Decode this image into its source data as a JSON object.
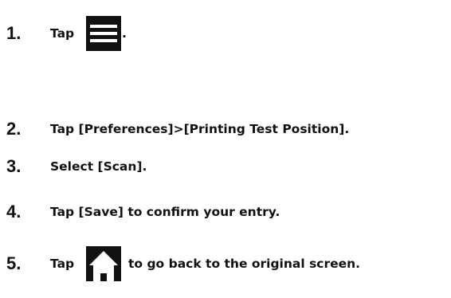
{
  "steps": [
    {
      "number": "1.",
      "before": "Tap",
      "icon": "menu-icon",
      "after": "."
    },
    {
      "number": "2.",
      "text": "Tap [Preferences]>[Printing Test Position]."
    },
    {
      "number": "3.",
      "text": "Select [Scan]."
    },
    {
      "number": "4.",
      "text": "Tap [Save] to confirm your entry."
    },
    {
      "number": "5.",
      "before": "Tap",
      "icon": "home-icon",
      "after": "to go back to the original screen."
    }
  ],
  "colors": {
    "text": "#111111",
    "icon_bg": "#111111",
    "icon_fg": "#ffffff"
  }
}
